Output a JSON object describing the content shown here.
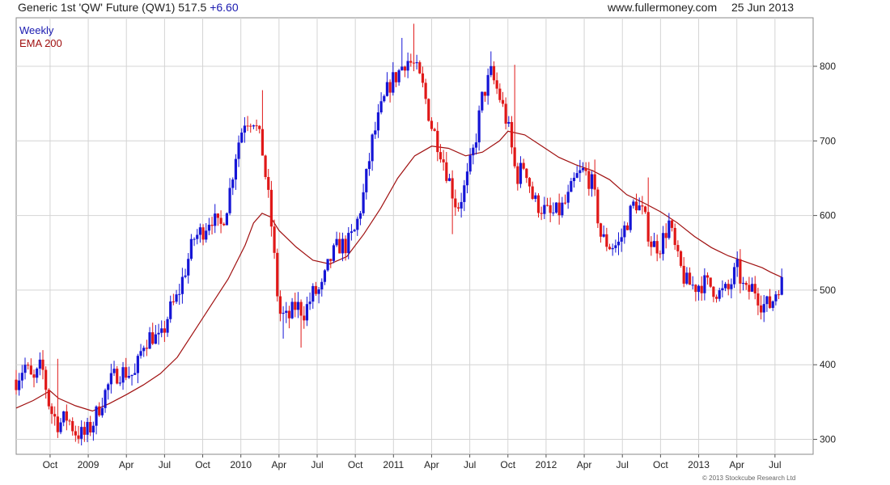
{
  "header": {
    "title": "Generic 1st 'QW' Future (QW1) 517.5",
    "change": "+6.60",
    "website": "www.fullermoney.com",
    "date": "25 Jun 2013"
  },
  "footer": {
    "copyright": "© 2013 Stockcube Research Ltd"
  },
  "colors": {
    "up": "#1515d6",
    "down": "#e01818",
    "ema": "#a01010",
    "grid": "#d4d4d4",
    "weekly_label": "#1a1ab0",
    "ema_label": "#a01010"
  },
  "chart_data": {
    "type": "candlestick",
    "frequency_label": "Weekly",
    "overlay_label": "EMA 200",
    "yticks": [
      300,
      400,
      500,
      600,
      700,
      800
    ],
    "ylim": [
      280,
      865
    ],
    "x_range": [
      -2.4,
      54.0
    ],
    "x_ticks": [
      {
        "t": 0,
        "label": "Oct"
      },
      {
        "t": 2.7,
        "label": "2009"
      },
      {
        "t": 5.4,
        "label": "Apr"
      },
      {
        "t": 8.1,
        "label": "Jul"
      },
      {
        "t": 10.8,
        "label": "Oct"
      },
      {
        "t": 13.5,
        "label": "2010"
      },
      {
        "t": 16.2,
        "label": "Apr"
      },
      {
        "t": 18.9,
        "label": "Jul"
      },
      {
        "t": 21.6,
        "label": "Oct"
      },
      {
        "t": 24.3,
        "label": "2011"
      },
      {
        "t": 27,
        "label": "Apr"
      },
      {
        "t": 29.7,
        "label": "Jul"
      },
      {
        "t": 32.4,
        "label": "Oct"
      },
      {
        "t": 35.1,
        "label": "2012"
      },
      {
        "t": 37.8,
        "label": "Apr"
      },
      {
        "t": 40.5,
        "label": "Jul"
      },
      {
        "t": 43.2,
        "label": "Oct"
      },
      {
        "t": 45.9,
        "label": "2013"
      },
      {
        "t": 48.6,
        "label": "Apr"
      },
      {
        "t": 51.3,
        "label": "Jul"
      }
    ],
    "close_path": [
      [
        -2.4,
        380
      ],
      [
        -1.8,
        400
      ],
      [
        -1.2,
        375
      ],
      [
        -0.6,
        400
      ],
      [
        0,
        340
      ],
      [
        0.6,
        320
      ],
      [
        1.2,
        330
      ],
      [
        1.8,
        310
      ],
      [
        2.4,
        305
      ],
      [
        3.0,
        320
      ],
      [
        3.6,
        350
      ],
      [
        4.2,
        375
      ],
      [
        4.8,
        390
      ],
      [
        5.4,
        390
      ],
      [
        6.0,
        385
      ],
      [
        6.6,
        430
      ],
      [
        7.2,
        440
      ],
      [
        7.8,
        430
      ],
      [
        8.4,
        470
      ],
      [
        9.0,
        490
      ],
      [
        9.6,
        530
      ],
      [
        10.2,
        570
      ],
      [
        10.8,
        580
      ],
      [
        11.4,
        600
      ],
      [
        12.0,
        580
      ],
      [
        12.6,
        620
      ],
      [
        13.2,
        690
      ],
      [
        13.8,
        730
      ],
      [
        14.4,
        730
      ],
      [
        15.0,
        690
      ],
      [
        15.6,
        600
      ],
      [
        16.2,
        470
      ],
      [
        16.8,
        460
      ],
      [
        17.4,
        480
      ],
      [
        18.0,
        470
      ],
      [
        18.6,
        495
      ],
      [
        19.2,
        500
      ],
      [
        19.8,
        540
      ],
      [
        20.4,
        560
      ],
      [
        21.0,
        560
      ],
      [
        21.6,
        580
      ],
      [
        22.2,
        630
      ],
      [
        22.8,
        700
      ],
      [
        23.4,
        740
      ],
      [
        24.0,
        775
      ],
      [
        24.6,
        790
      ],
      [
        25.2,
        810
      ],
      [
        25.8,
        800
      ],
      [
        26.4,
        770
      ],
      [
        27.0,
        720
      ],
      [
        27.6,
        690
      ],
      [
        28.2,
        650
      ],
      [
        28.8,
        610
      ],
      [
        29.4,
        640
      ],
      [
        30.0,
        690
      ],
      [
        30.6,
        760
      ],
      [
        31.2,
        790
      ],
      [
        31.8,
        760
      ],
      [
        32.4,
        720
      ],
      [
        33.0,
        650
      ],
      [
        33.6,
        670
      ],
      [
        34.2,
        620
      ],
      [
        34.8,
        610
      ],
      [
        35.4,
        600
      ],
      [
        36.0,
        605
      ],
      [
        36.6,
        620
      ],
      [
        37.2,
        650
      ],
      [
        37.8,
        660
      ],
      [
        38.4,
        640
      ],
      [
        39.0,
        570
      ],
      [
        39.6,
        560
      ],
      [
        40.2,
        560
      ],
      [
        40.8,
        590
      ],
      [
        41.4,
        620
      ],
      [
        42.0,
        600
      ],
      [
        42.6,
        560
      ],
      [
        43.2,
        560
      ],
      [
        43.8,
        590
      ],
      [
        44.4,
        540
      ],
      [
        45.0,
        510
      ],
      [
        45.6,
        505
      ],
      [
        46.2,
        510
      ],
      [
        46.8,
        505
      ],
      [
        47.4,
        495
      ],
      [
        48.0,
        500
      ],
      [
        48.6,
        530
      ],
      [
        49.2,
        495
      ],
      [
        49.8,
        505
      ],
      [
        50.4,
        480
      ],
      [
        51.0,
        480
      ],
      [
        51.4,
        500
      ],
      [
        51.8,
        517.5
      ]
    ],
    "ema_path": [
      [
        -2.4,
        342
      ],
      [
        -1.2,
        352
      ],
      [
        0,
        365
      ],
      [
        0.6,
        355
      ],
      [
        1.8,
        345
      ],
      [
        3.0,
        338
      ],
      [
        4.2,
        348
      ],
      [
        5.4,
        360
      ],
      [
        6.6,
        373
      ],
      [
        7.8,
        388
      ],
      [
        9.0,
        410
      ],
      [
        10.2,
        445
      ],
      [
        11.4,
        480
      ],
      [
        12.6,
        515
      ],
      [
        13.8,
        560
      ],
      [
        14.4,
        590
      ],
      [
        15.0,
        603
      ],
      [
        15.6,
        598
      ],
      [
        16.2,
        580
      ],
      [
        17.4,
        558
      ],
      [
        18.6,
        540
      ],
      [
        19.8,
        535
      ],
      [
        21.0,
        545
      ],
      [
        22.2,
        575
      ],
      [
        23.4,
        610
      ],
      [
        24.6,
        650
      ],
      [
        25.8,
        680
      ],
      [
        27.0,
        693
      ],
      [
        28.2,
        690
      ],
      [
        29.4,
        680
      ],
      [
        30.6,
        685
      ],
      [
        31.8,
        700
      ],
      [
        32.4,
        713
      ],
      [
        33.6,
        708
      ],
      [
        34.8,
        693
      ],
      [
        36.0,
        678
      ],
      [
        37.2,
        668
      ],
      [
        38.4,
        660
      ],
      [
        39.6,
        648
      ],
      [
        40.8,
        628
      ],
      [
        42.0,
        617
      ],
      [
        43.2,
        605
      ],
      [
        44.4,
        590
      ],
      [
        45.6,
        572
      ],
      [
        46.8,
        557
      ],
      [
        48.0,
        546
      ],
      [
        49.2,
        538
      ],
      [
        50.4,
        530
      ],
      [
        51.0,
        524
      ],
      [
        51.8,
        517
      ]
    ],
    "key_lows": [
      [
        -2.4,
        360
      ],
      [
        1.5,
        305
      ],
      [
        2.3,
        293
      ],
      [
        16.5,
        435
      ],
      [
        17.8,
        423
      ],
      [
        28.5,
        575
      ],
      [
        45.6,
        485
      ],
      [
        50.6,
        472
      ]
    ],
    "key_highs": [
      [
        0.5,
        408
      ],
      [
        15.0,
        768
      ],
      [
        25.0,
        838
      ],
      [
        25.8,
        857
      ],
      [
        31.2,
        820
      ],
      [
        32.8,
        802
      ],
      [
        38.5,
        675
      ],
      [
        42.3,
        651
      ],
      [
        48.6,
        546
      ]
    ],
    "last_close": 517.5,
    "last_change": 6.6
  }
}
